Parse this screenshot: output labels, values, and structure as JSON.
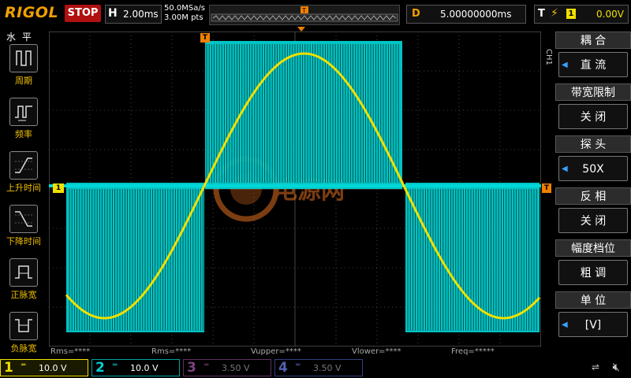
{
  "topbar": {
    "brand": "RIGOL",
    "run_state": "STOP",
    "h_label": "H",
    "timebase": "2.00ms",
    "sample_rate": "50.0MSa/s",
    "mem_depth": "3.00M pts",
    "delay_label": "D",
    "delay_value": "5.00000000ms",
    "trig_label": "T",
    "trig_source": "1",
    "trig_level": "0.00V"
  },
  "left_menu": {
    "title": "水 平",
    "items": [
      {
        "label": "周期",
        "icon": "period-icon"
      },
      {
        "label": "频率",
        "icon": "frequency-icon"
      },
      {
        "label": "上升时间",
        "icon": "rise-time-icon"
      },
      {
        "label": "下降时间",
        "icon": "fall-time-icon"
      },
      {
        "label": "正脉宽",
        "icon": "positive-width-icon"
      },
      {
        "label": "负脉宽",
        "icon": "negative-width-icon"
      }
    ]
  },
  "right_menu": {
    "channel_tag": "CH1",
    "items": [
      {
        "head": "耦 合",
        "value": "直 流",
        "arrow": true
      },
      {
        "head": "带宽限制",
        "value": "关 闭",
        "arrow": false
      },
      {
        "head": "探 头",
        "value": "50X",
        "arrow": true
      },
      {
        "head": "反 相",
        "value": "关 闭",
        "arrow": false
      },
      {
        "head": "幅度档位",
        "value": "粗 调",
        "arrow": false
      },
      {
        "head": "单 位",
        "value": "[V]",
        "arrow": true
      }
    ]
  },
  "markers": {
    "ch1_marker": "1",
    "trig_marker": "T"
  },
  "measurements": {
    "rms1": "Rms=****",
    "rms2": "Rms=****",
    "vupper": "Vupper=****",
    "vlower": "Vlower=****",
    "freq": "Freq=*****"
  },
  "channels": [
    {
      "num": "1",
      "coupling": "═",
      "scale": "10.0 V",
      "color": "#f0e000"
    },
    {
      "num": "2",
      "coupling": "═",
      "scale": "10.0 V",
      "color": "#00d0d0"
    },
    {
      "num": "3",
      "coupling": "═",
      "scale": "3.50 V",
      "color": "#c040c0"
    },
    {
      "num": "4",
      "coupling": "═",
      "scale": "3.50 V",
      "color": "#4060e0"
    }
  ],
  "watermark": "电源网",
  "colors": {
    "ch1": "#f0e000",
    "ch2": "#00d8d8",
    "trigger": "#f08000",
    "grid": "#555555"
  }
}
